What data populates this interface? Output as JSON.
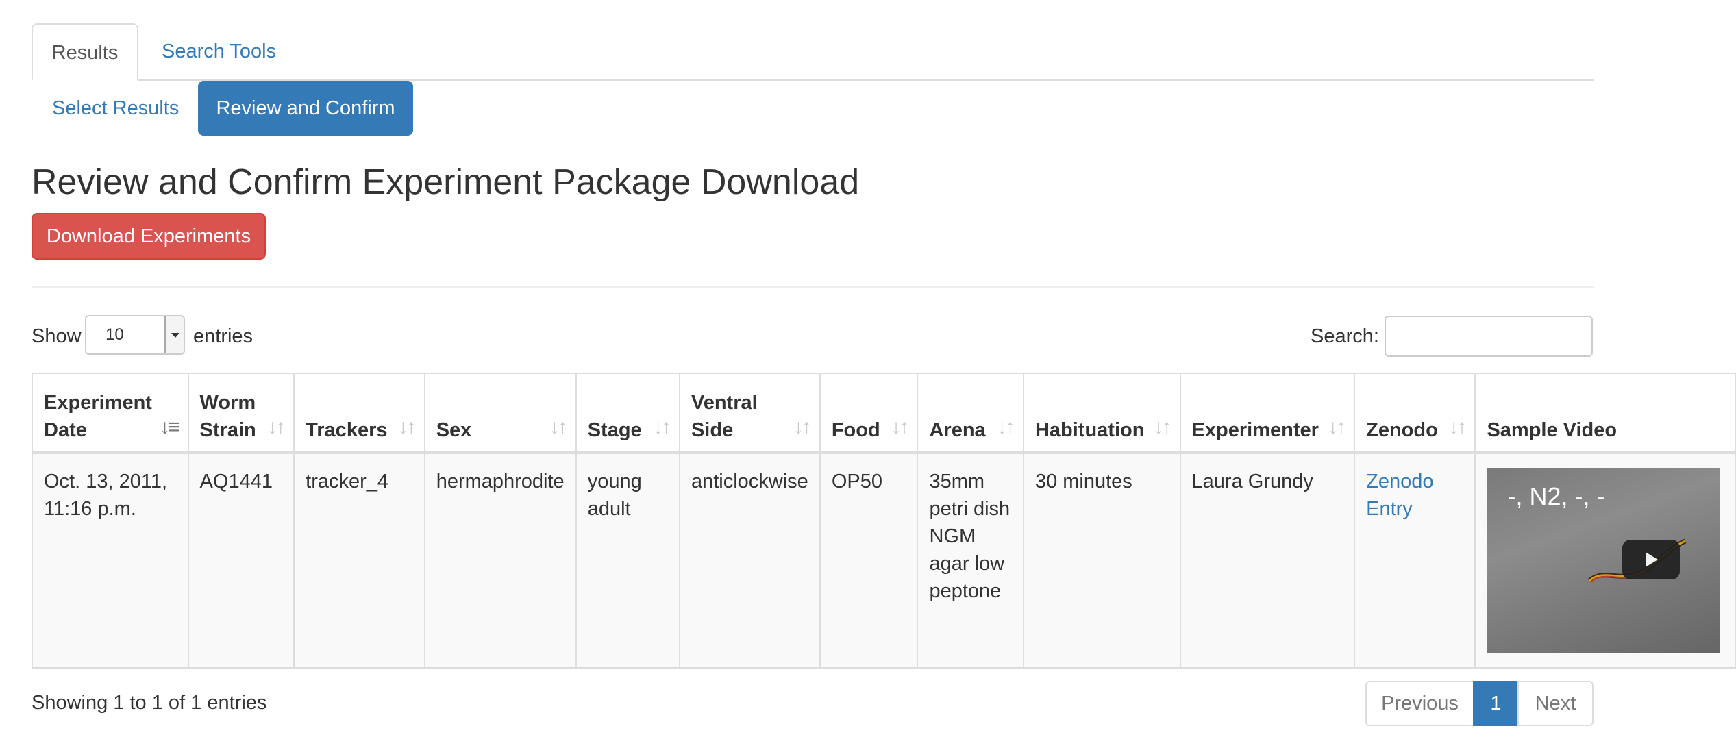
{
  "tabs": {
    "results": "Results",
    "search_tools": "Search Tools"
  },
  "pills": {
    "select_results": "Select Results",
    "review_confirm": "Review and Confirm"
  },
  "page_title": "Review and Confirm Experiment Package Download",
  "download_button": "Download Experiments",
  "length": {
    "show": "Show",
    "value": "10",
    "entries": "entries"
  },
  "search": {
    "label": "Search:",
    "value": ""
  },
  "table": {
    "headers": {
      "experiment_date": [
        "Experiment",
        "Date"
      ],
      "worm_strain": [
        "Worm",
        "Strain"
      ],
      "trackers": "Trackers",
      "sex": "Sex",
      "stage": "Stage",
      "ventral_side": [
        "Ventral",
        "Side"
      ],
      "food": "Food",
      "arena": "Arena",
      "habituation": "Habituation",
      "experimenter": "Experimenter",
      "zenodo": "Zenodo",
      "sample_video": "Sample Video"
    },
    "rows": [
      {
        "experiment_date": [
          "Oct. 13, 2011,",
          "11:16 p.m."
        ],
        "worm_strain": "AQ1441",
        "trackers": "tracker_4",
        "sex": "hermaphrodite",
        "stage": [
          "young",
          "adult"
        ],
        "ventral_side": "anticlockwise",
        "food": "OP50",
        "arena": [
          "35mm",
          "petri dish",
          "NGM",
          "agar low",
          "peptone"
        ],
        "habituation": "30 minutes",
        "experimenter": "Laura Grundy",
        "zenodo": [
          "Zenodo",
          "Entry"
        ],
        "video_title": "-, N2, -, -"
      }
    ]
  },
  "footer": {
    "info": "Showing 1 to 1 of 1 entries",
    "previous": "Previous",
    "current_page": "1",
    "next": "Next"
  },
  "colors": {
    "primary": "#337ab7",
    "danger": "#d9534f",
    "border": "#dddddd"
  },
  "icons": {
    "sort": "sort-icon",
    "sort_asc": "sort-asc-icon",
    "play": "play-icon",
    "caret": "caret-down-icon"
  }
}
